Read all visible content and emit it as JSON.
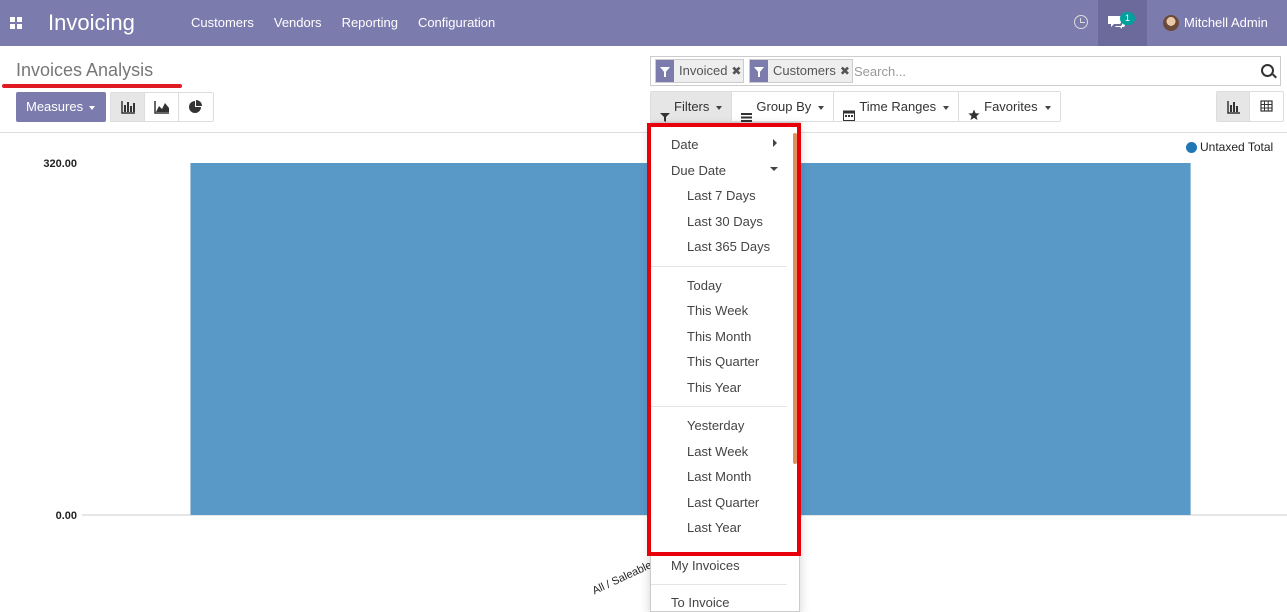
{
  "navbar": {
    "brand": "Invoicing",
    "menu": [
      "Customers",
      "Vendors",
      "Reporting",
      "Configuration"
    ],
    "chat_badge": "1",
    "user": "Mitchell Admin",
    "color": "#7c7bad"
  },
  "control_panel": {
    "title": "Invoices Analysis",
    "measures_label": "Measures",
    "search": {
      "facets": [
        "Invoiced",
        "Customers"
      ],
      "placeholder": "Search..."
    },
    "filter_buttons": [
      "Filters",
      "Group By",
      "Time Ranges",
      "Favorites"
    ]
  },
  "filters_dropdown": {
    "date": "Date",
    "due_date": "Due Date",
    "due_date_options": [
      "Last 7 Days",
      "Last 30 Days",
      "Last 365 Days"
    ],
    "current_periods": [
      "Today",
      "This Week",
      "This Month",
      "This Quarter",
      "This Year"
    ],
    "previous_periods": [
      "Yesterday",
      "Last Week",
      "Last Month",
      "Last Quarter",
      "Last Year"
    ],
    "my_invoices": "My Invoices",
    "to_invoice": "To Invoice"
  },
  "chart_data": {
    "type": "bar",
    "categories": [
      "All / Saleable / Office"
    ],
    "series": [
      {
        "name": "Untaxed Total",
        "values": [
          320
        ]
      }
    ],
    "ylim": [
      0,
      320
    ],
    "ytick_labels": [
      "0.00",
      "320.00"
    ],
    "grid": false,
    "legend": "top-right",
    "color": "#5899c8"
  }
}
